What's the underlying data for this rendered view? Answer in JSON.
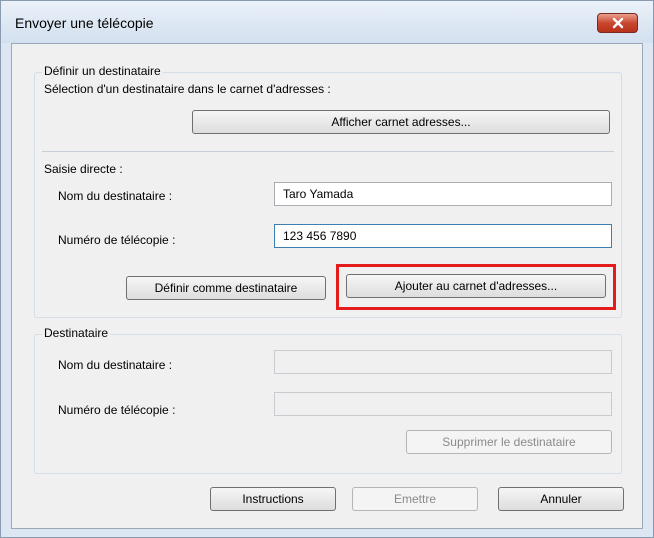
{
  "window": {
    "title": "Envoyer une télécopie",
    "close_icon": "close-icon"
  },
  "define": {
    "group_label": "Définir un destinataire",
    "addressbook_caption": "Sélection d'un destinataire dans le carnet d'adresses :",
    "show_addressbook_button": "Afficher carnet adresses..."
  },
  "direct": {
    "label": "Saisie directe :",
    "name_label": "Nom du destinataire :",
    "name_value": "Taro Yamada",
    "fax_label": "Numéro de télécopie :",
    "fax_value": "123 456 7890",
    "set_recipient_button": "Définir comme destinataire",
    "add_to_addressbook_button": "Ajouter au carnet d'adresses...",
    "highlight_color": "#e51c1c"
  },
  "recipient": {
    "group_label": "Destinataire",
    "name_label": "Nom du destinataire :",
    "name_value": "",
    "fax_label": "Numéro de télécopie :",
    "fax_value": "",
    "delete_button": "Supprimer le destinataire"
  },
  "footer": {
    "instructions_button": "Instructions",
    "send_button": "Emettre",
    "cancel_button": "Annuler"
  }
}
